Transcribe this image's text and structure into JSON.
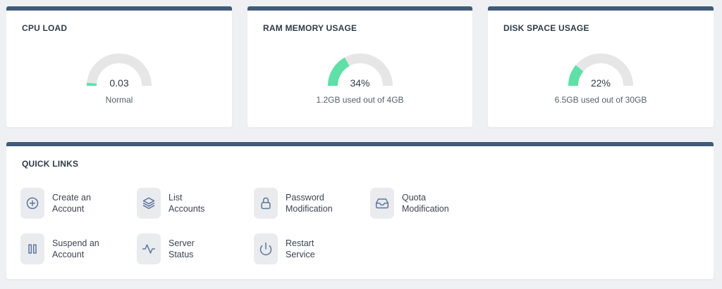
{
  "colors": {
    "card_border": "#3f5b78",
    "gauge_fill": "#5fe0a6",
    "gauge_track": "#e6e6e6",
    "icon_stroke": "#5d76a0"
  },
  "cards": {
    "cpu": {
      "title": "CPU LOAD",
      "value": "0.03",
      "caption": "Normal",
      "fraction": 0.03
    },
    "ram": {
      "title": "RAM MEMORY USAGE",
      "value": "34%",
      "caption": "1.2GB used out of 4GB",
      "fraction": 0.34
    },
    "disk": {
      "title": "DISK SPACE USAGE",
      "value": "22%",
      "caption": "6.5GB used out of 30GB",
      "fraction": 0.22
    }
  },
  "quick_links": {
    "title": "QUICK LINKS",
    "items": [
      {
        "label": "Create an\nAccount",
        "icon": "plus-circle-icon"
      },
      {
        "label": "List\nAccounts",
        "icon": "layers-icon"
      },
      {
        "label": "Password\nModification",
        "icon": "lock-icon"
      },
      {
        "label": "Quota\nModification",
        "icon": "inbox-icon"
      },
      {
        "label": "Suspend an\nAccount",
        "icon": "pause-icon"
      },
      {
        "label": "Server\nStatus",
        "icon": "activity-icon"
      },
      {
        "label": "Restart\nService",
        "icon": "power-icon"
      }
    ]
  }
}
